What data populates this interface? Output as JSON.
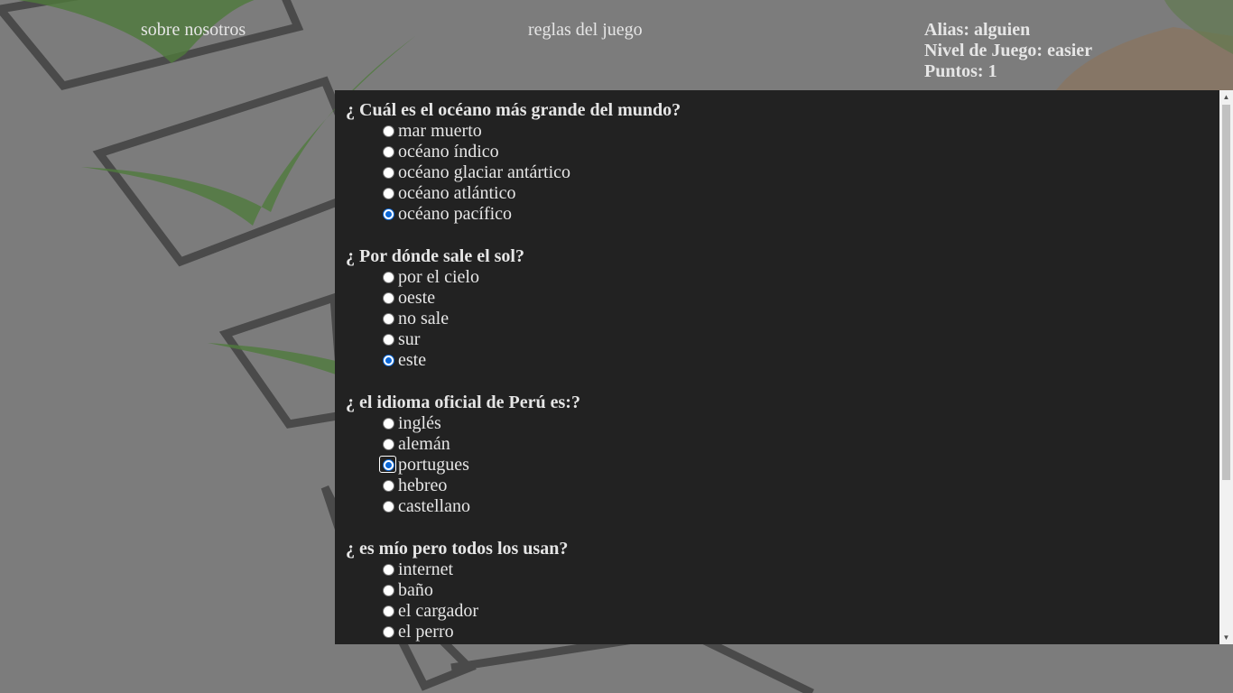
{
  "nav": {
    "about_label": "sobre nosotros",
    "rules_label": "reglas del juego"
  },
  "player": {
    "alias": "Alias: alguien",
    "level": "Nivel de Juego: easier",
    "points": "Puntos: 1"
  },
  "quiz": {
    "questions": [
      {
        "text": "¿ Cuál es el océano más grande del mundo?",
        "options": [
          "mar muerto",
          "océano índico",
          "océano glaciar antártico",
          "océano atlántico",
          "océano pacífico"
        ],
        "selected": 4
      },
      {
        "text": "¿ Por dónde sale el sol?",
        "options": [
          "por el cielo",
          "oeste",
          "no sale",
          "sur",
          "este"
        ],
        "selected": 4
      },
      {
        "text": "¿ el idioma oficial de Perú es:?",
        "options": [
          "inglés",
          "alemán",
          "portugues",
          "hebreo",
          "castellano"
        ],
        "selected": 2
      },
      {
        "text": "¿ es mío pero todos los usan?",
        "options": [
          "internet",
          "baño",
          "el cargador",
          "el perro"
        ],
        "selected": -1
      }
    ]
  },
  "colors": {
    "panel_bg": "#222222",
    "text": "#e6e6e6",
    "radio_accent": "#0a66d6"
  }
}
